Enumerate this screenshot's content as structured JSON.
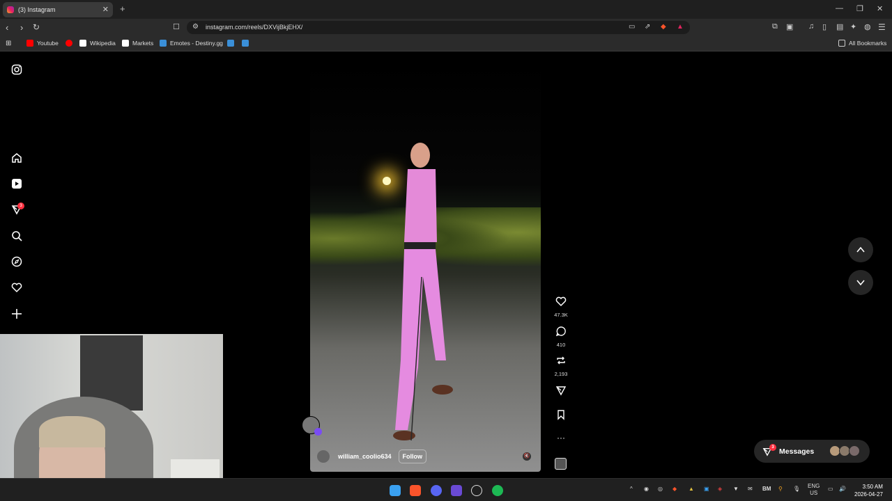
{
  "browser": {
    "tab_title": "(3) Instagram",
    "new_tab": "+",
    "url": "instagram.com/reels/DXVijBkjEHX/",
    "bookmarks": [
      {
        "label": "Youtube",
        "color": "#ff0000"
      },
      {
        "label": "",
        "color": "#ff0000"
      },
      {
        "label": "Wikipedia",
        "color": "#ffffff"
      },
      {
        "label": "Markets",
        "color": "#ffffff"
      },
      {
        "label": "Emotes - Destiny.gg",
        "color": "#3a8fd8"
      },
      {
        "label": "",
        "color": "#3a8fd8"
      },
      {
        "label": "",
        "color": "#3a8fd8"
      }
    ],
    "all_bookmarks": "All Bookmarks"
  },
  "sidebar": {
    "notifications_badge": "3"
  },
  "reel": {
    "username": "william_coolio634",
    "follow_label": "Follow"
  },
  "actions": {
    "likes": "47.3K",
    "comments": "410",
    "reposts": "2,193"
  },
  "messages": {
    "label": "Messages",
    "badge": "3"
  },
  "taskbar": {
    "lang_top": "ENG",
    "lang_bottom": "US",
    "time": "3:50 AM",
    "date": "2026-04-27",
    "bm_label": "BM"
  }
}
